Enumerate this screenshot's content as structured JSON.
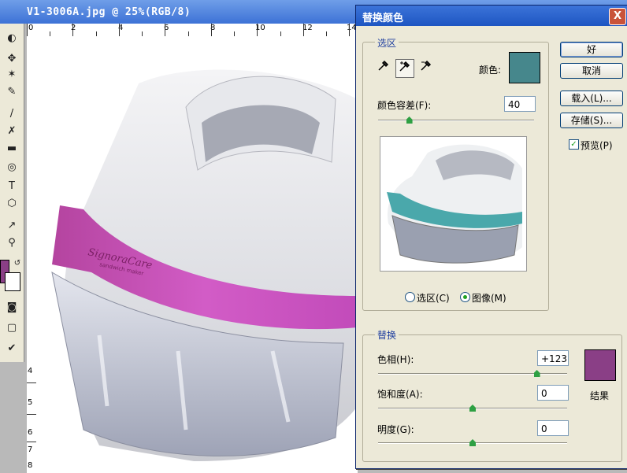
{
  "document": {
    "title": "V1-3006A.jpg @ 25%(RGB/8)",
    "ruler_top_labels": [
      "0",
      "2",
      "4",
      "6",
      "8",
      "10",
      "12",
      "14"
    ],
    "ruler_left_labels": [
      "4",
      "5",
      "6",
      "7",
      "8"
    ],
    "product_brand": "SignoraCare",
    "product_tagline": "sandwich maker"
  },
  "dialog": {
    "title": "替换颜色",
    "close_label": "X",
    "selection": {
      "group_label": "选区",
      "color_label": "颜色:",
      "color_value": "#46878c",
      "fuzziness_label": "颜色容差(F):",
      "fuzziness_value": "40",
      "fuzziness_fraction": 0.2,
      "radio_selection": "选区(C)",
      "radio_image": "图像(M)",
      "selected_radio": "image"
    },
    "buttons": {
      "ok": "好",
      "cancel": "取消",
      "load": "载入(L)...",
      "save": "存储(S)...",
      "preview": "预览(P)",
      "preview_checked": true
    },
    "replace": {
      "group_label": "替换",
      "hue_label": "色相(H):",
      "hue_value": "+123",
      "hue_fraction": 0.84,
      "saturation_label": "饱和度(A):",
      "saturation_value": "0",
      "saturation_fraction": 0.5,
      "lightness_label": "明度(G):",
      "lightness_value": "0",
      "lightness_fraction": 0.5,
      "result_label": "结果",
      "result_color": "#8a3f86"
    }
  },
  "colors": {
    "accent_pink": "#c04bb8",
    "preview_teal": "#4aa8ab"
  }
}
